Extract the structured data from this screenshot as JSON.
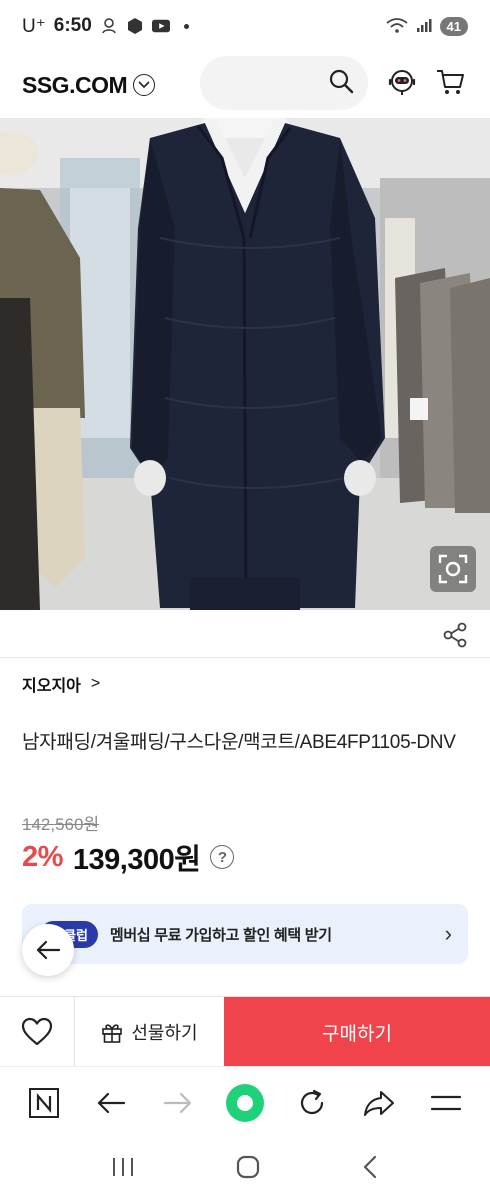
{
  "status_bar": {
    "carrier": "U⁺",
    "time": "6:50",
    "battery": "41"
  },
  "header": {
    "logo": "SSG.COM",
    "search_placeholder": ""
  },
  "brand": {
    "name": "지오지아",
    "chevron": ">"
  },
  "product": {
    "name": "남자패딩/겨울패딩/구스다운/맥코트/ABE4FP1105-DNV",
    "original_price": "142,560원",
    "discount": "2%",
    "sale_price": "139,300원",
    "help": "?"
  },
  "membership": {
    "badge": "클럽",
    "text": "멤버십 무료 가입하고 할인 혜택 받기",
    "chevron": "›"
  },
  "actions": {
    "gift_label": "선물하기",
    "buy_label": "구매하기"
  },
  "colors": {
    "buy_button": "#f0434b",
    "discount": "#e84a4a",
    "banner_bg": "#eaf0fc",
    "club_badge": "#2a3aa8",
    "browser_home": "#1fd27a"
  }
}
